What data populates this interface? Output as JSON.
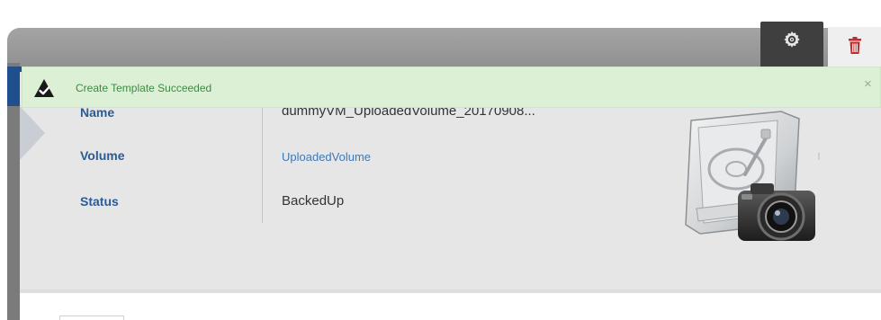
{
  "toolbar": {
    "settings_icon": "gear-icon",
    "delete_icon": "trash-icon",
    "delete_color": "#c42b2b"
  },
  "notification": {
    "message": "Create Template Succeeded",
    "icon": "check-in-triangle-icon",
    "close_symbol": "×",
    "background": "#dcf0d6",
    "text_color": "#3d8a43"
  },
  "details": {
    "rows": [
      {
        "label": "Name",
        "value": "dummyVM_UploadedVolume_20170908..."
      },
      {
        "label": "Volume",
        "value": "UploadedVolume",
        "is_link": true
      },
      {
        "label": "Status",
        "value": "BackedUp"
      }
    ],
    "image": "volume-snapshot-icon",
    "label_color": "#2a5b96",
    "link_color": "#3d7ab8"
  }
}
